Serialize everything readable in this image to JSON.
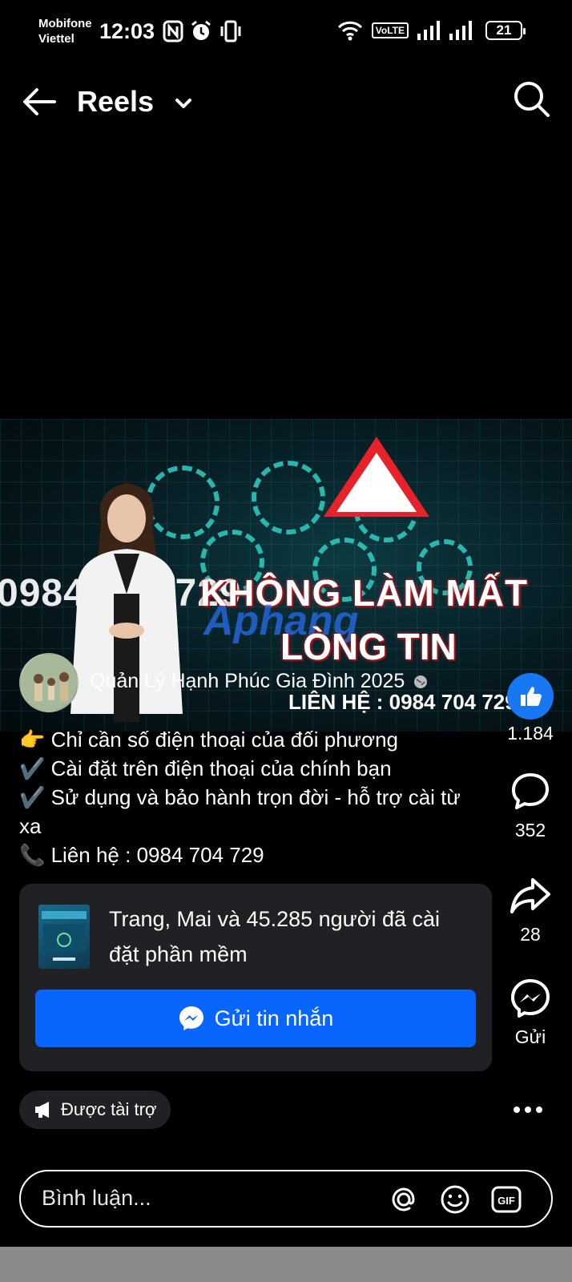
{
  "status_bar": {
    "carrier_line1": "Mobifone",
    "carrier_line2": "Viettel",
    "time": "12:03",
    "volte": "VoLTE",
    "battery": "21",
    "icons_left": [
      "nfc-icon",
      "alarm-icon",
      "vibrate-icon"
    ],
    "icons_right": [
      "wifi-icon",
      "volte-icon",
      "signal-icon",
      "signal-icon",
      "battery-icon"
    ]
  },
  "top_nav": {
    "title": "Reels",
    "icons": [
      "back-arrow-icon",
      "chevron-down-icon",
      "search-icon"
    ]
  },
  "video": {
    "headline_line1": "KHÔNG LÀM MẤT",
    "headline_line2": "LÒNG TIN",
    "phone_overlay": "0984 704 729",
    "watermark": "Aphang",
    "contact_line": "LIÊN HỆ : 0984 704 729"
  },
  "author": {
    "name": "Quản Lý Hạnh Phúc Gia Đình 2025"
  },
  "caption": {
    "line1": "👉 Chỉ cần số điện thoại của đối phương",
    "line2": "✔️ Cài đặt trên điện thoại của chính bạn",
    "line3": "✔️ Sử dụng và bảo hành trọn đời - hỗ trợ cài từ xa",
    "line4": "📞 Liên hệ : 0984 704 729"
  },
  "actions": {
    "likes": "1.184",
    "comments": "352",
    "shares": "28",
    "send_label": "Gửi"
  },
  "ad_card": {
    "social_text": "Trang, Mai và 45.285 người đã cài đặt phần mềm",
    "button_label": "Gửi tin nhắn"
  },
  "sponsored_label": "Được tài trợ",
  "comment": {
    "placeholder": "Bình luận..."
  },
  "colors": {
    "background": "#000000",
    "accent_blue": "#0866ff",
    "like_blue": "#1877f2",
    "card_bg": "#1f2124"
  }
}
